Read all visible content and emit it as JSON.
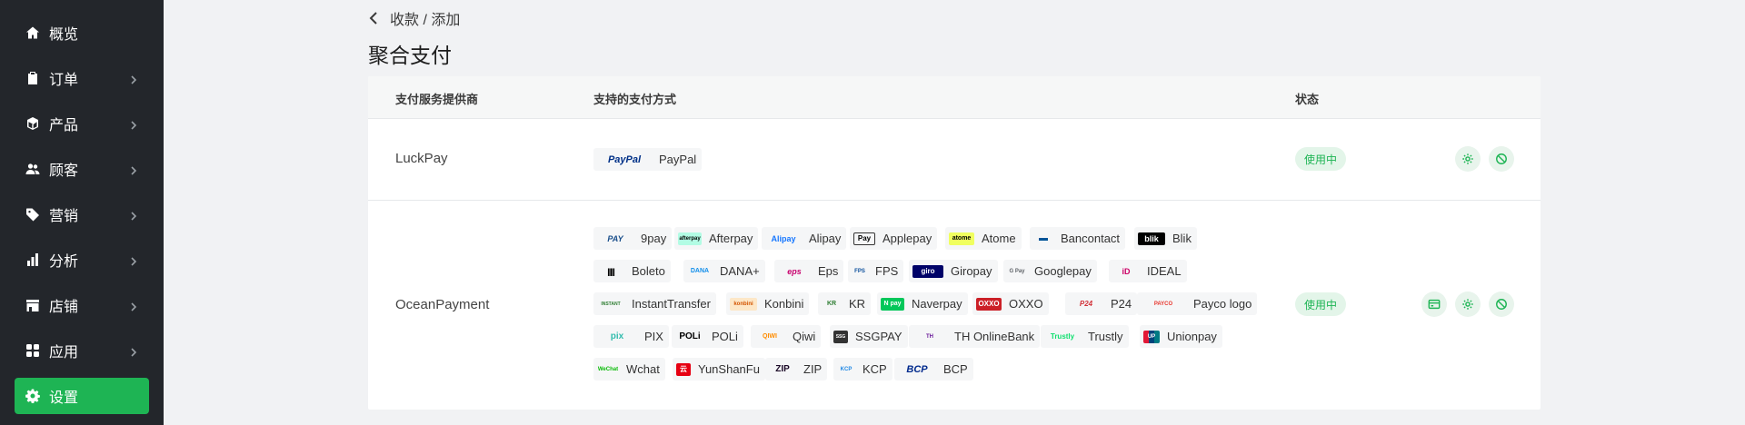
{
  "sidebar": {
    "items": [
      {
        "label": "概览",
        "icon": "home-icon"
      },
      {
        "label": "订单",
        "icon": "clipboard-icon"
      },
      {
        "label": "产品",
        "icon": "box-icon"
      },
      {
        "label": "顾客",
        "icon": "users-icon"
      },
      {
        "label": "营销",
        "icon": "tag-icon"
      },
      {
        "label": "分析",
        "icon": "bar-chart-icon"
      },
      {
        "label": "店铺",
        "icon": "store-icon"
      },
      {
        "label": "应用",
        "icon": "apps-icon"
      },
      {
        "label": "设置",
        "icon": "gear-icon",
        "active": true
      }
    ]
  },
  "breadcrumb": {
    "text": "收款 / 添加"
  },
  "page": {
    "title": "聚合支付"
  },
  "table": {
    "headers": {
      "provider": "支付服务提供商",
      "methods": "支持的支付方式",
      "status": "状态"
    },
    "rows": [
      {
        "provider": "LuckPay",
        "status": "使用中",
        "methods": [
          {
            "name": "PayPal",
            "logo_text": "PayPal"
          }
        ]
      },
      {
        "provider": "OceanPayment",
        "status": "使用中",
        "methods": [
          {
            "name": "9pay",
            "logo_text": "PAY"
          },
          {
            "name": "Afterpay",
            "logo_text": "afterpay"
          },
          {
            "name": "Alipay",
            "logo_text": "Alipay"
          },
          {
            "name": "Applepay",
            "logo_text": "Pay"
          },
          {
            "name": "Atome",
            "logo_text": "atome"
          },
          {
            "name": "Bancontact",
            "logo_text": "▬"
          },
          {
            "name": "Blik",
            "logo_text": "blik"
          },
          {
            "name": "Boleto",
            "logo_text": "|||||"
          },
          {
            "name": "DANA+",
            "logo_text": "DANA"
          },
          {
            "name": "Eps",
            "logo_text": "eps"
          },
          {
            "name": "FPS",
            "logo_text": "FPS"
          },
          {
            "name": "Giropay",
            "logo_text": "giro"
          },
          {
            "name": "Googlepay",
            "logo_text": "G Pay"
          },
          {
            "name": "IDEAL",
            "logo_text": "iD"
          },
          {
            "name": "InstantTransfer",
            "logo_text": "INSTANT"
          },
          {
            "name": "Konbini",
            "logo_text": "konbini"
          },
          {
            "name": "KR",
            "logo_text": "KR"
          },
          {
            "name": "Naverpay",
            "logo_text": "N pay"
          },
          {
            "name": "OXXO",
            "logo_text": "OXXO"
          },
          {
            "name": "P24",
            "logo_text": "P24"
          },
          {
            "name": "Payco logo",
            "logo_text": "PAYCO"
          },
          {
            "name": "PIX",
            "logo_text": "pix"
          },
          {
            "name": "POLi",
            "logo_text": "POLi"
          },
          {
            "name": "Qiwi",
            "logo_text": "QIWI"
          },
          {
            "name": "SSGPAY",
            "logo_text": "SSG"
          },
          {
            "name": "TH OnlineBank",
            "logo_text": "TH"
          },
          {
            "name": "Trustly",
            "logo_text": "Trustly"
          },
          {
            "name": "Unionpay",
            "logo_text": "UP"
          },
          {
            "name": "Wchat",
            "logo_text": "WeChat"
          },
          {
            "name": "YunShanFu",
            "logo_text": "云"
          },
          {
            "name": "ZIP",
            "logo_text": "ZIP"
          },
          {
            "name": "KCP",
            "logo_text": "KCP"
          },
          {
            "name": "BCP",
            "logo_text": "BCP"
          }
        ]
      }
    ]
  },
  "colors": {
    "accent": "#1eb454",
    "sidebar_bg": "#23262b",
    "status_bg": "#e3f5e9"
  }
}
